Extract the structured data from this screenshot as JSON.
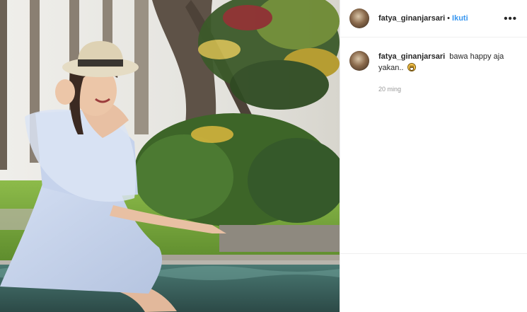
{
  "post": {
    "photo_alt": "",
    "author": {
      "username": "fatya_ginanjarsari",
      "separator": "•",
      "follow_label": "Ikuti",
      "more_icon": "more-options-icon",
      "more_label": "•••"
    },
    "caption": {
      "username": "fatya_ginanjarsari",
      "text": "bawa happy aja yakan..",
      "emoji_icon": "grinning-face-icon",
      "time_ago": "20 ming"
    }
  },
  "colors": {
    "link_blue": "#3897f0",
    "text_dark": "#262626",
    "muted": "#999999",
    "border": "#efefef"
  }
}
